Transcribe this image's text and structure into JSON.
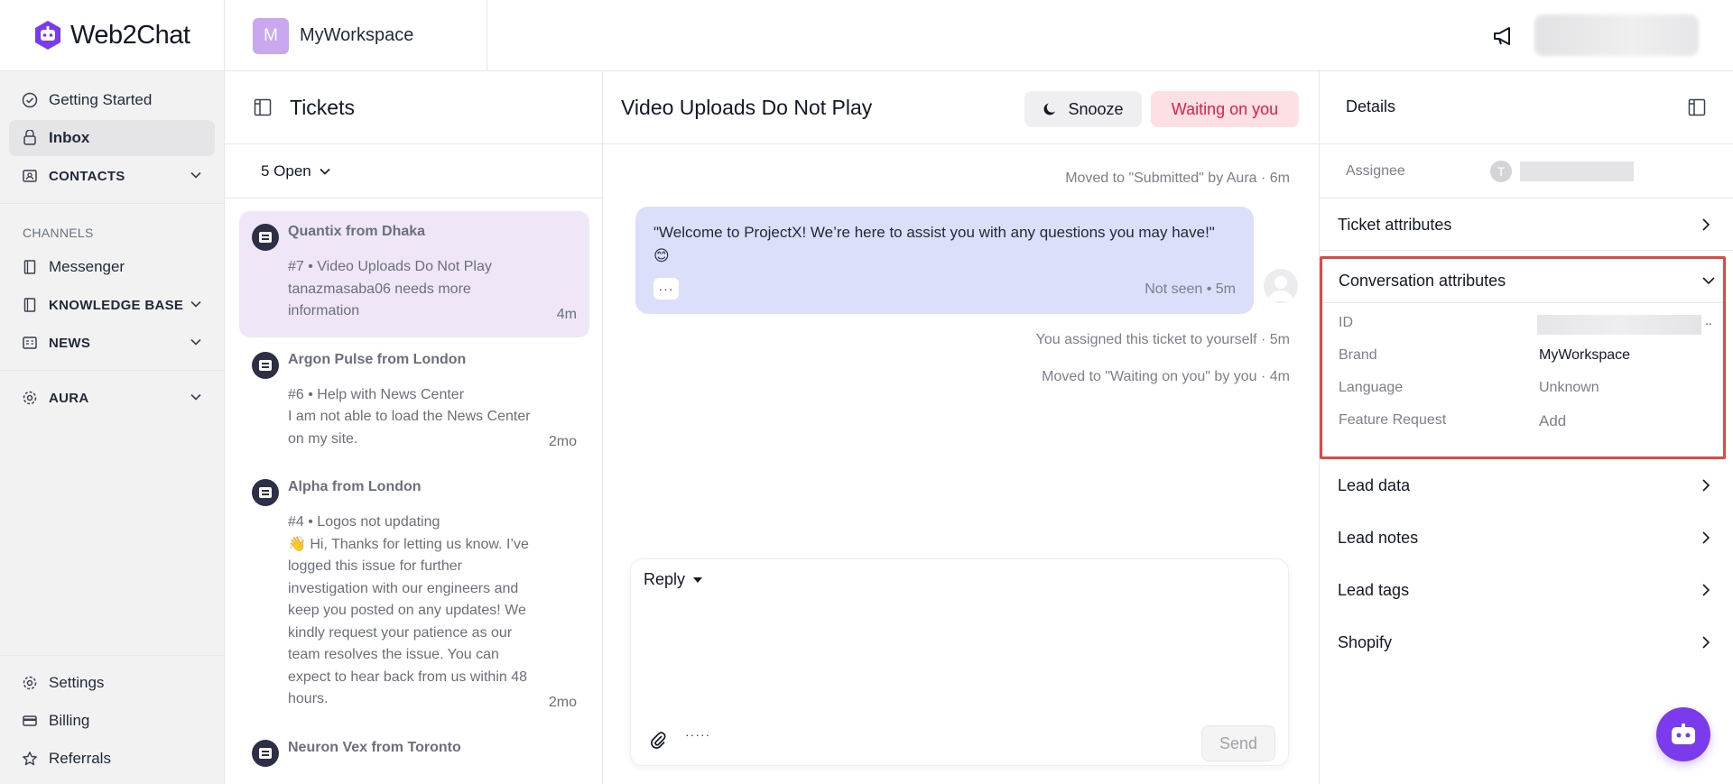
{
  "brand": {
    "name": "Web2Chat",
    "color": "#7c3aed"
  },
  "workspace": {
    "initial": "M",
    "name": "MyWorkspace"
  },
  "sidebar": {
    "items": [
      {
        "label": "Getting Started",
        "icon": "check-circle-icon"
      },
      {
        "label": "Inbox",
        "icon": "inbox-icon",
        "active": true
      },
      {
        "label": "CONTACTS",
        "icon": "contacts-icon"
      }
    ],
    "channels_label": "CHANNELS",
    "channels": [
      {
        "label": "Messenger",
        "icon": "book-icon"
      },
      {
        "label": "KNOWLEDGE BASE",
        "icon": "book-icon"
      },
      {
        "label": "NEWS",
        "icon": "news-icon"
      }
    ],
    "aura": {
      "label": "AURA",
      "icon": "gear-icon"
    },
    "bottom": [
      {
        "label": "Settings",
        "icon": "gear-icon"
      },
      {
        "label": "Billing",
        "icon": "card-icon"
      },
      {
        "label": "Referrals",
        "icon": "star-icon"
      }
    ]
  },
  "tickets": {
    "title": "Tickets",
    "filter": "5 Open",
    "list": [
      {
        "name": "Quantix from Dhaka",
        "lines": [
          "#7 • Video Uploads Do Not Play",
          "tanazmasaba06 needs more information"
        ],
        "time": "4m"
      },
      {
        "name": "Argon Pulse from London",
        "lines": [
          "#6 • Help with News Center",
          "I am not able to load the News Center on my site."
        ],
        "time": "2mo"
      },
      {
        "name": "Alpha from London",
        "lines": [
          "#4 • Logos not updating",
          "👋 Hi, Thanks for letting us know. I’ve logged this issue for further investigation with our engineers and keep you posted on any updates! We kindly request your patience as our team resolves the issue. You can expect to hear back from us within 48 hours."
        ],
        "time": "2mo"
      },
      {
        "name": "Neuron Vex from Toronto",
        "lines": [],
        "time": ""
      }
    ]
  },
  "conversation": {
    "title": "Video Uploads Do Not Play",
    "snooze_label": "Snooze",
    "status_label": "Waiting on you",
    "events": [
      "Moved to \"Submitted\" by Aura · 6m",
      "You assigned this ticket to yourself · 5m",
      "Moved to \"Waiting on you\" by you · 4m"
    ],
    "message": {
      "text": "\"Welcome to ProjectX! We’re here to assist you with any questions you may have!\" 😊",
      "more": "···",
      "meta": "Not seen • 5m"
    },
    "composer": {
      "mode": "Reply",
      "dots": "·····",
      "send_label": "Send"
    }
  },
  "details": {
    "title": "Details",
    "assignee_label": "Assignee",
    "assignee_initial": "T",
    "ticket_attributes": "Ticket attributes",
    "conversation_attributes": {
      "label": "Conversation attributes",
      "rows": [
        {
          "key": "ID",
          "value": ""
        },
        {
          "key": "Brand",
          "value": "MyWorkspace"
        },
        {
          "key": "Language",
          "value": "Unknown"
        },
        {
          "key": "Feature Request",
          "value": "Add"
        }
      ],
      "id_dots": ".."
    },
    "sections": [
      "Lead data",
      "Lead notes",
      "Lead tags",
      "Shopify"
    ]
  }
}
